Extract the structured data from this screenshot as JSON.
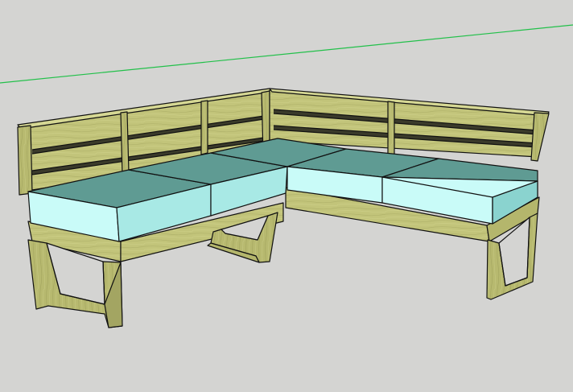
{
  "scene": {
    "background_color": "#d4d4d2",
    "green_axis_color": "#22c04a",
    "wood_color": "#c2c47a",
    "wood_dark_color": "#9fa160",
    "wood_light_color": "#d6d894",
    "cushion_top_color": "#5f9b93",
    "cushion_side_light_color": "#c9fbf8",
    "cushion_side_mid_color": "#a8e9e5",
    "cushion_side_dark_color": "#8ad3cf",
    "edge_color": "#111111"
  }
}
